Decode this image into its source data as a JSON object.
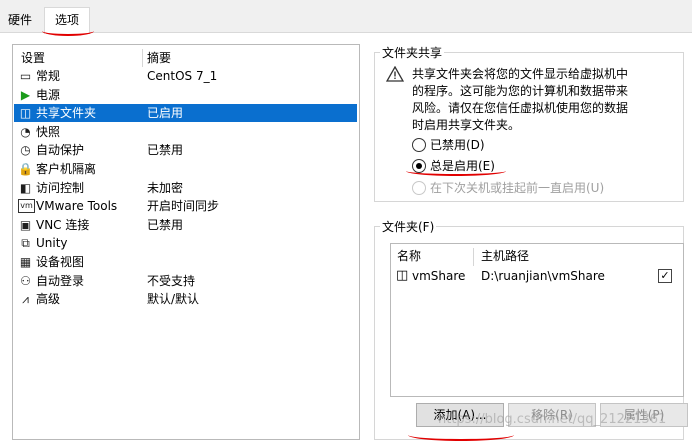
{
  "tabs": [
    {
      "label": "硬件"
    },
    {
      "label": "选项"
    }
  ],
  "settings_list": {
    "col_setting": "设置",
    "col_summary": "摘要",
    "rows": [
      {
        "name": "常规",
        "summary": "CentOS 7_1",
        "icon": "window-icon",
        "glyph": "▭"
      },
      {
        "name": "电源",
        "summary": "",
        "icon": "power-play-icon",
        "glyph": "▶"
      },
      {
        "name": "共享文件夹",
        "summary": "已启用",
        "icon": "shared-folder-icon",
        "glyph": "◫",
        "selected": true
      },
      {
        "name": "快照",
        "summary": "",
        "icon": "snapshot-icon",
        "glyph": "◔"
      },
      {
        "name": "自动保护",
        "summary": "已禁用",
        "icon": "auto-protect-icon",
        "glyph": "◷"
      },
      {
        "name": "客户机隔离",
        "summary": "",
        "icon": "lock-icon",
        "glyph": "🔒"
      },
      {
        "name": "访问控制",
        "summary": "未加密",
        "icon": "access-control-icon",
        "glyph": "◧"
      },
      {
        "name": "VMware Tools",
        "summary": "开启时间同步",
        "icon": "vmware-tools-icon",
        "glyph": "vm"
      },
      {
        "name": "VNC 连接",
        "summary": "已禁用",
        "icon": "vnc-icon",
        "glyph": "▣"
      },
      {
        "name": "Unity",
        "summary": "",
        "icon": "unity-icon",
        "glyph": "⧉"
      },
      {
        "name": "设备视图",
        "summary": "",
        "icon": "device-view-icon",
        "glyph": "▦"
      },
      {
        "name": "自动登录",
        "summary": "不受支持",
        "icon": "users-icon",
        "glyph": "⚇"
      },
      {
        "name": "高级",
        "summary": "默认/默认",
        "icon": "advanced-icon",
        "glyph": "⩘"
      }
    ]
  },
  "sharing": {
    "title": "文件夹共享",
    "warning_icon": "warning-triangle-icon",
    "warning_lines": [
      "共享文件夹会将您的文件显示给虚拟机中",
      "的程序。这可能为您的计算机和数据带来",
      "风险。请仅在您信任虚拟机使用您的数据",
      "时启用共享文件夹。"
    ],
    "options": [
      {
        "label": "已禁用(D)",
        "checked": false,
        "enabled": true
      },
      {
        "label": "总是启用(E)",
        "checked": true,
        "enabled": true
      },
      {
        "label": "在下次关机或挂起前一直启用(U)",
        "checked": false,
        "enabled": false
      }
    ]
  },
  "folders": {
    "title": "文件夹(F)",
    "col_name": "名称",
    "col_path": "主机路径",
    "items": [
      {
        "name": "vmShare",
        "path": "D:\\ruanjian\\vmShare",
        "enabled": true
      }
    ],
    "buttons": {
      "add": "添加(A)...",
      "remove": "移除(R)",
      "properties": "属性(P)"
    }
  },
  "watermark": "https://blog.csdn.net/qq_21221361",
  "colors": {
    "selection": "#0a6fcf",
    "annotation": "#e10000"
  }
}
